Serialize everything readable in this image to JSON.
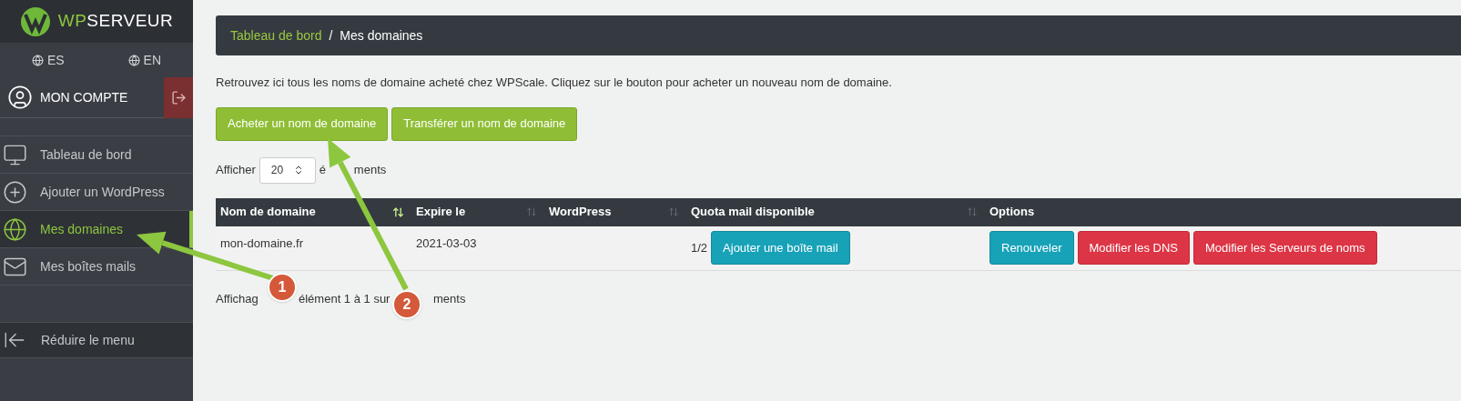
{
  "sidebar": {
    "logo": {
      "brand_accent": "WP",
      "brand_rest": "SERVEUR"
    },
    "languages": [
      {
        "code": "ES"
      },
      {
        "code": "EN"
      }
    ],
    "account": {
      "label": "MON COMPTE"
    },
    "menu": [
      {
        "label": "Tableau de bord",
        "kind": "monitor",
        "selected": false
      },
      {
        "label": "Ajouter un WordPress",
        "kind": "plus",
        "selected": false
      },
      {
        "label": "Mes domaines",
        "kind": "globe",
        "selected": true
      },
      {
        "label": "Mes boîtes mails",
        "kind": "mail",
        "selected": false
      }
    ],
    "collapse": {
      "label": "Réduire le menu"
    }
  },
  "breadcrumb": [
    {
      "label": "Tableau de bord",
      "current": false
    },
    {
      "label": "Mes domaines",
      "current": true
    }
  ],
  "breadcrumb_separator": "/",
  "intro": "Retrouvez ici tous les noms de domaine acheté chez WPScale. Cliquez sur le bouton pour acheter un nouveau nom de domaine.",
  "actions": [
    "Acheter un nom de domaine",
    "Transférer un nom de domaine"
  ],
  "page_length": {
    "prefix": "Afficher",
    "value": "20",
    "suffix_parts": [
      "é",
      "ments"
    ]
  },
  "table": {
    "columns": [
      {
        "label": "Nom de domaine",
        "kind": "sortable",
        "sorted": true
      },
      {
        "label": "Expire le",
        "kind": "sortable",
        "sorted": false
      },
      {
        "label": "WordPress",
        "kind": "sortable",
        "sorted": false
      },
      {
        "label": "Quota mail disponible",
        "kind": "sortable",
        "sorted": false
      },
      {
        "label": "Options",
        "kind": "plain"
      }
    ],
    "rows": [
      {
        "domain": "mon-domaine.fr",
        "expires": "2021-03-03",
        "quota": "1/2",
        "quota_button": "Ajouter une boîte mail",
        "options": [
          {
            "label": "Renouveler",
            "kind": "info"
          },
          {
            "label": "Modifier les DNS",
            "kind": "danger"
          },
          {
            "label": "Modifier les Serveurs de noms",
            "kind": "danger"
          }
        ]
      }
    ]
  },
  "footer_parts": [
    "Affichag",
    "élément 1 à 1 sur",
    "ments"
  ],
  "annotations": [
    {
      "number": "1"
    },
    {
      "number": "2"
    }
  ]
}
